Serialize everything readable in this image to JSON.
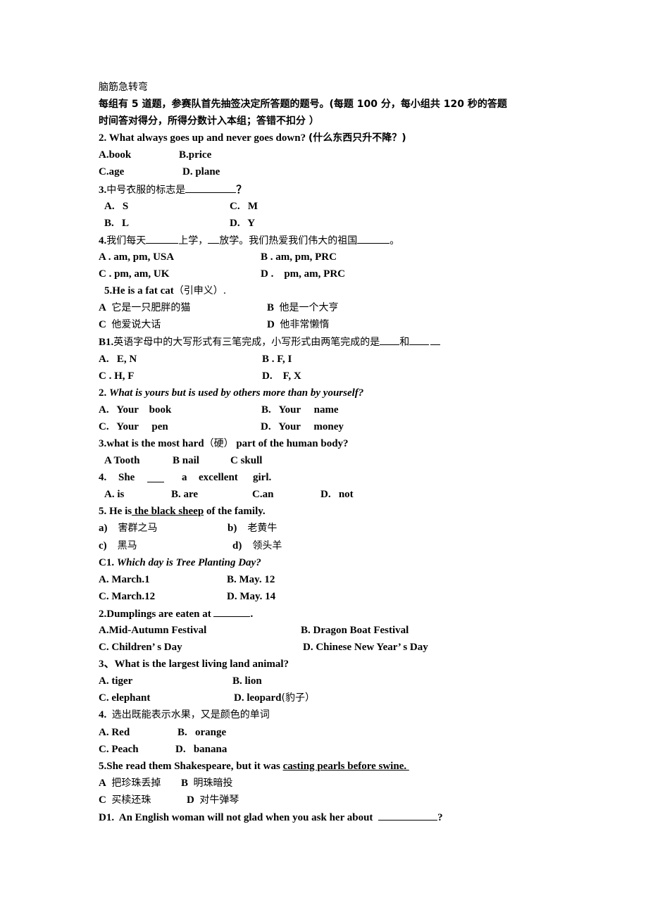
{
  "title": "脑筋急转弯",
  "intro": {
    "line1": "每组有 5 道题，参赛队首先抽签决定所答题的题号。(每题 100 分，每小组共 120 秒的答题",
    "line2": "时间答对得分，所得分数计入本组；答错不扣分 ）"
  },
  "groupA": {
    "q2": {
      "text": "2. What always goes up and never goes down? ",
      "cn": "(什么东西只升不降？)",
      "options": [
        "A.book",
        "B.price",
        "C.age",
        "D. plane"
      ]
    },
    "q3": {
      "prefix": "3.",
      "text": "中号衣服的标志是",
      "suffix": "？",
      "options": [
        "A.   S",
        "C.   M",
        "B.   L",
        "D.   Y"
      ]
    },
    "q4": {
      "prefix": "4.",
      "part1": "我们每天",
      "part2": "上学，",
      "part3": "放学。我们热爱我们伟大的祖国",
      "part4": "。",
      "options": [
        "A . am, pm, USA",
        "B . am, pm, PRC",
        "C . pm, am, UK",
        "D .    pm, am, PRC"
      ]
    },
    "q5": {
      "text": "5.He is a fat cat",
      "cn": "（引申义）.",
      "options": [
        {
          "letter": "A",
          "text": "它是一只肥胖的猫"
        },
        {
          "letter": "B",
          "text": "他是一个大亨"
        },
        {
          "letter": "C",
          "text": "他爱说大话"
        },
        {
          "letter": "D",
          "text": "他非常懒惰"
        }
      ]
    }
  },
  "groupB": {
    "q1": {
      "prefix": "B1.",
      "text": "英语字母中的大写形式有三笔完成，小写形式由两笔完成的是",
      "mid": "和",
      "options": [
        "A.   E, N",
        "B . F, I",
        "C . H, F",
        "D.    F, X"
      ]
    },
    "q2": {
      "num": "2. ",
      "text": "What is yours but is used by others more than by yourself?",
      "options": [
        "A.   Your    book",
        "B.   Your     name",
        "C.   Your     pen",
        "D.   Your     money"
      ]
    },
    "q3": {
      "text1": "3.what is the most hard",
      "cn": "（硬）",
      "text2": " part of the human body?",
      "options": [
        "A Tooth",
        "B nail",
        "C skull"
      ]
    },
    "q4": {
      "words": [
        "4.",
        "She",
        "a",
        "excellent",
        "girl."
      ],
      "options": [
        "A. is",
        "B. are",
        "C.an",
        "D.   not"
      ]
    },
    "q5": {
      "pre": "5. He is",
      "underlined": " the black sheep",
      "post": " of the family.",
      "options": [
        {
          "letter": "a)",
          "text": "害群之马"
        },
        {
          "letter": "b)",
          "text": "老黄牛"
        },
        {
          "letter": "c)",
          "text": "黑马"
        },
        {
          "letter": "d)",
          "text": "领头羊"
        }
      ]
    }
  },
  "groupC": {
    "q1": {
      "num": "C1. ",
      "text": "Which day is Tree Planting Day?",
      "options": [
        "A. March.1",
        "B. May. 12",
        "C. March.12",
        "D. May. 14"
      ]
    },
    "q2": {
      "text": "2.Dumplings are eaten at ",
      "suffix": ".",
      "options": [
        "A.Mid-Autumn Festival",
        "B. Dragon Boat Festival",
        "C. Children’ s Day",
        "D. Chinese New Year’ s Day"
      ]
    },
    "q3": {
      "text": "3、What is the largest living land animal?",
      "options": [
        "A. tiger",
        "B. lion",
        "C. elephant",
        "D. leopard"
      ],
      "d_cn": "(豹子）"
    },
    "q4": {
      "prefix": "4.  ",
      "text": "选出既能表示水果，又是颜色的单词",
      "options": [
        "A. Red",
        "B.   orange",
        "C. Peach",
        "D.   banana"
      ]
    },
    "q5": {
      "pre": "5.She read them Shakespeare, but it was ",
      "underlined": "casting pearls before swine. ",
      "options": [
        {
          "letter": "A",
          "text": "把珍珠丢掉"
        },
        {
          "letter": "B",
          "text": "明珠暗投"
        },
        {
          "letter": "C",
          "text": "买椟还珠"
        },
        {
          "letter": "D",
          "text": "对牛弹琴"
        }
      ]
    }
  },
  "groupD": {
    "q1": {
      "text": "D1.  An English woman will not glad when you ask her about ",
      "suffix": "?"
    }
  }
}
